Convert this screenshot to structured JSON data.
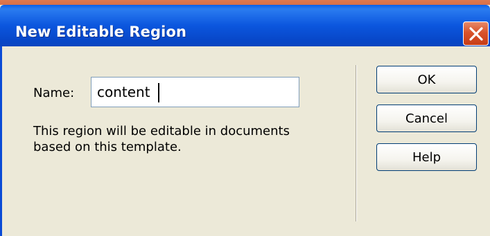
{
  "dialog": {
    "title": "New Editable Region",
    "name_label": "Name:",
    "name_value": "content",
    "description": "This region will be editable in documents based on this template.",
    "buttons": {
      "ok": "OK",
      "cancel": "Cancel",
      "help": "Help"
    },
    "close_icon": "close-icon"
  },
  "colors": {
    "titlebar": "#0a56de",
    "dialog_background": "#ece9d8",
    "close_button": "#d9532b",
    "button_border": "#003c74"
  }
}
